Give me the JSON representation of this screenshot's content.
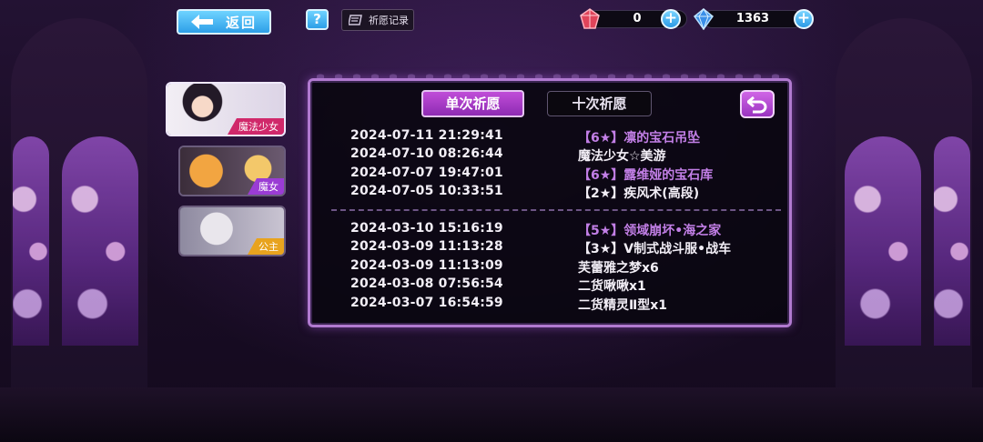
{
  "top_bar": {
    "back_label": "返回",
    "help_label": "?",
    "record_label": "祈愿记录",
    "red_currency": {
      "icon": "red-crystal-icon",
      "value": "0"
    },
    "blue_currency": {
      "icon": "blue-crystal-icon",
      "value": "1363"
    },
    "plus_label": "+"
  },
  "characters": [
    {
      "tag": "魔法少女",
      "tag_color": "#d0286a",
      "selected": true
    },
    {
      "tag": "魔女",
      "tag_color": "#9a3cd4",
      "selected": false
    },
    {
      "tag": "公主",
      "tag_color": "#e8a31e",
      "selected": false
    }
  ],
  "panel": {
    "tabs": [
      {
        "label": "单次祈愿",
        "active": true
      },
      {
        "label": "十次祈愿",
        "active": false
      }
    ],
    "single_records": [
      {
        "time": "2024-07-11 21:29:41",
        "item": "【6★】凛的宝石吊坠",
        "highlight": true
      },
      {
        "time": "2024-07-10 08:26:44",
        "item": "魔法少女☆美游",
        "highlight": false
      },
      {
        "time": "2024-07-07 19:47:01",
        "item": "【6★】露维娅的宝石库",
        "highlight": true
      },
      {
        "time": "2024-07-05 10:33:51",
        "item": "【2★】疾风术(高段)",
        "highlight": false
      }
    ],
    "ten_records": [
      {
        "time": "2024-03-10 15:16:19",
        "item": "【5★】领域崩坏•海之家",
        "highlight": true
      },
      {
        "time": "2024-03-09 11:13:28",
        "item": "【3★】V制式战斗服•战车",
        "highlight": false
      },
      {
        "time": "2024-03-09 11:13:09",
        "item": "芙蕾雅之梦x6",
        "highlight": false
      },
      {
        "time": "2024-03-08 07:56:54",
        "item": "二货啾啾x1",
        "highlight": false
      },
      {
        "time": "2024-03-07 16:54:59",
        "item": "二货精灵Ⅱ型x1",
        "highlight": false
      }
    ],
    "accent_purple": "#c27fe6"
  }
}
